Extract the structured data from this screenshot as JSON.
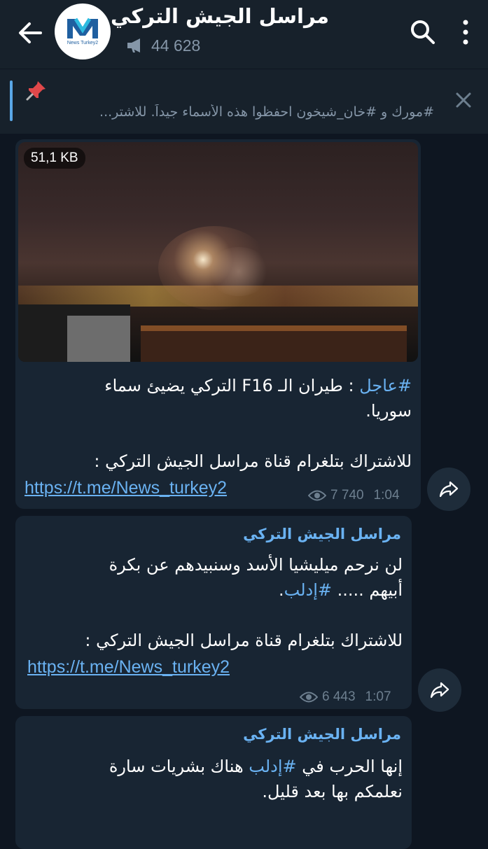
{
  "header": {
    "title": "مراسل الجيش التركي",
    "subscribers": "44 628",
    "avatar_label": "News Turkey2"
  },
  "pinned": {
    "text": "#مورك و #خان_شيخون احفظوا هذه الأسماء جيداً.  للاشتر..."
  },
  "messages": [
    {
      "file_size": "51,1 KB",
      "hashtag": "#عاجل",
      "text_after_hashtag": " : طيران الـ F16 التركي يضيئ سماء",
      "line2": "سوريا.",
      "subscribe_text": "للاشتراك بتلغرام قناة مراسل الجيش التركي :",
      "link": "https://t.me/News_turkey2",
      "views": "7 740",
      "time": "1:04"
    },
    {
      "sender": "مراسل الجيش التركي",
      "line1": "لن نرحم ميليشيا الأسد وسنبيدهم عن بكرة",
      "line2_text": "أبيهم ..... ",
      "line2_hashtag": "#إدلب",
      "line2_end": ".",
      "subscribe_text": "للاشتراك بتلغرام قناة مراسل الجيش التركي :",
      "link": "https://t.me/News_turkey2",
      "views": "6 443",
      "time": "1:07"
    },
    {
      "sender": "مراسل الجيش التركي",
      "line1_start": "إنها الحرب في ",
      "line1_hashtag": "#إدلب",
      "line1_end": " هناك بشريات سارة",
      "line2": "نعلمكم بها بعد قليل."
    }
  ],
  "colors": {
    "background": "#0e1621",
    "header": "#17212b",
    "bubble": "#182533",
    "accent": "#6ab2f2",
    "muted": "#6d7f8f"
  },
  "icons": [
    "back-arrow-icon",
    "megaphone-icon",
    "search-icon",
    "more-vertical-icon",
    "pin-icon",
    "close-icon",
    "eye-icon",
    "share-icon"
  ]
}
